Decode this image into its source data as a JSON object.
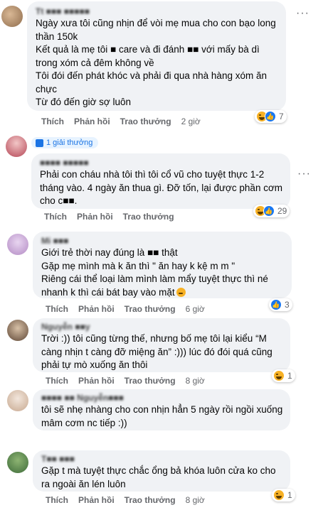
{
  "actions": {
    "like": "Thích",
    "reply": "Phản hồi",
    "award": "Trao thưởng"
  },
  "comments": [
    {
      "author": "Tt ■■■ ■■■■■",
      "lines": [
        "Ngày xưa tôi cũng nhịn để vòi mẹ mua cho con bạo long thần 150k",
        "Kết quả là mẹ tôi ■ care và đi đánh ■■ với mấy bà dì trong xóm cả đêm không về",
        "Tôi đói đến phát khóc và phải đi qua nhà hàng xóm ăn chực",
        "Từ đó đến giờ sợ luôn"
      ],
      "time": "2 giờ",
      "reaction_count": "7"
    },
    {
      "award_badge": "1 giải thưởng",
      "author": "■■■■ ■■■■■",
      "lines": [
        "Phải con cháu nhà tôi thì tôi cổ vũ cho tuyệt thực 1-2 tháng vào. 4 ngày ăn thua gì. Đỡ tốn, lại được phần cơm cho c■■."
      ],
      "time": "",
      "reaction_count": "29"
    },
    {
      "author": "Mi ■■■",
      "lines": [
        "Giới trẻ thời nay đúng là ■■ thật",
        "Gặp mẹ mình mà k ăn thì \" ăn hay k kệ m m \"",
        "Riêng cái thể loại làm mình làm mẩy tuyệt thực thì né nhanh k thì cái bát bay vào mặt"
      ],
      "time": "6 giờ",
      "reaction_count": "3"
    },
    {
      "author": "Nguyễn ■■y",
      "lines": [
        "Trời :)) tôi cũng từng thế, nhưng bố mẹ tôi lại kiểu “M càng nhịn t càng đỡ miệng ăn” :))) lúc đó đói quá cũng phải tự mò xuống ăn thôi"
      ],
      "time": "8 giờ",
      "reaction_count": "1"
    },
    {
      "author": "■■■■ ■■ Nguyễn■■■",
      "lines": [
        "tôi sẽ nhẹ nhàng cho con nhịn hẳn 5 ngày rồi ngồi xuống mâm cơm nc tiếp :))"
      ],
      "time": "",
      "reaction_count": ""
    },
    {
      "author": "T■■ ■■■",
      "lines": [
        "Gặp t mà tuyệt thực chắc ổng bả khóa luôn cửa ko cho ra ngoài ăn lén luôn"
      ],
      "time": "8 giờ",
      "reaction_count": "1"
    }
  ]
}
